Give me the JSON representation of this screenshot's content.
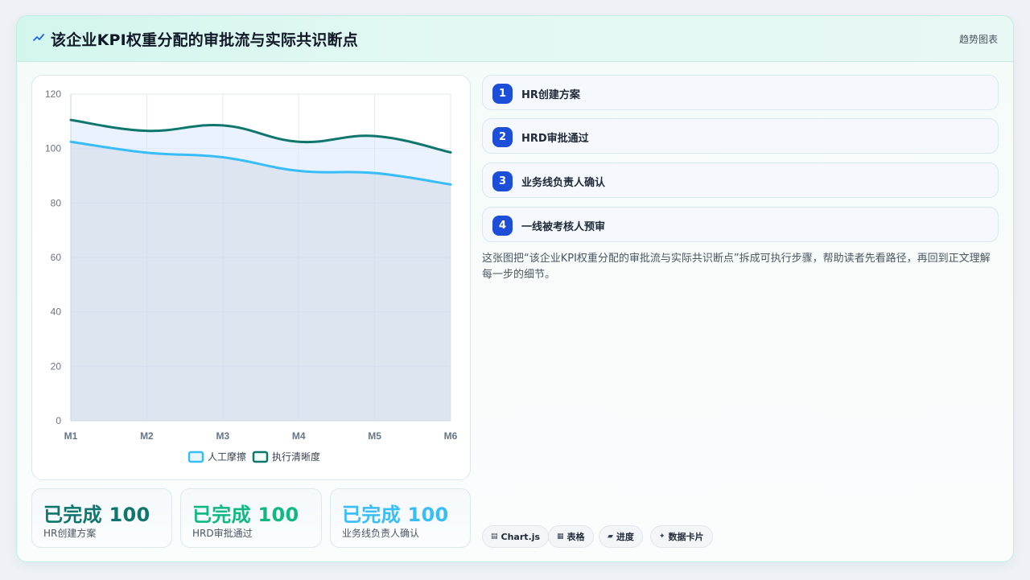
{
  "header": {
    "icon": "sparkline-icon",
    "title": "该企业KPI权重分配的审批流与实际共识断点",
    "badge": "趋势图表"
  },
  "chart_data": {
    "type": "line",
    "categories": [
      "M1",
      "M2",
      "M3",
      "M4",
      "M5",
      "M6"
    ],
    "series": [
      {
        "name": "人工摩擦",
        "values": [
          102.5,
          98.5,
          96.8,
          91.8,
          91.0,
          86.8
        ],
        "color": "#38bdf8",
        "fill": true
      },
      {
        "name": "执行清晰度",
        "values": [
          110.5,
          106.5,
          108.5,
          102.5,
          104.6,
          98.6
        ],
        "color": "#0f766e",
        "fill": true
      }
    ],
    "ylim": [
      0,
      120
    ],
    "yticks": [
      0,
      20,
      40,
      60,
      80,
      100,
      120
    ],
    "grid": true,
    "legend": "bottom"
  },
  "stats": [
    {
      "value": "已完成 100",
      "label": "HR创建方案",
      "color": "#0f766e"
    },
    {
      "value": "已完成 100",
      "label": "HRD审批通过",
      "color": "#10b981"
    },
    {
      "value": "已完成 100",
      "label": "业务线负责人确认",
      "color": "#38bdf8"
    }
  ],
  "steps": [
    {
      "num": "1",
      "label": "HR创建方案"
    },
    {
      "num": "2",
      "label": "HRD审批通过"
    },
    {
      "num": "3",
      "label": "业务线负责人确认"
    },
    {
      "num": "4",
      "label": "一线被考核人预审"
    }
  ],
  "description": "这张图把“该企业KPI权重分配的审批流与实际共识断点”拆成可执行步骤，帮助读者先看路径，再回到正文理解每一步的细节。",
  "tags": [
    {
      "icon": "▤",
      "label": "Chart.js"
    },
    {
      "icon": "▦",
      "label": "表格"
    },
    {
      "icon": "▰",
      "label": "进度"
    },
    {
      "icon": "✦",
      "label": "数据卡片"
    }
  ]
}
